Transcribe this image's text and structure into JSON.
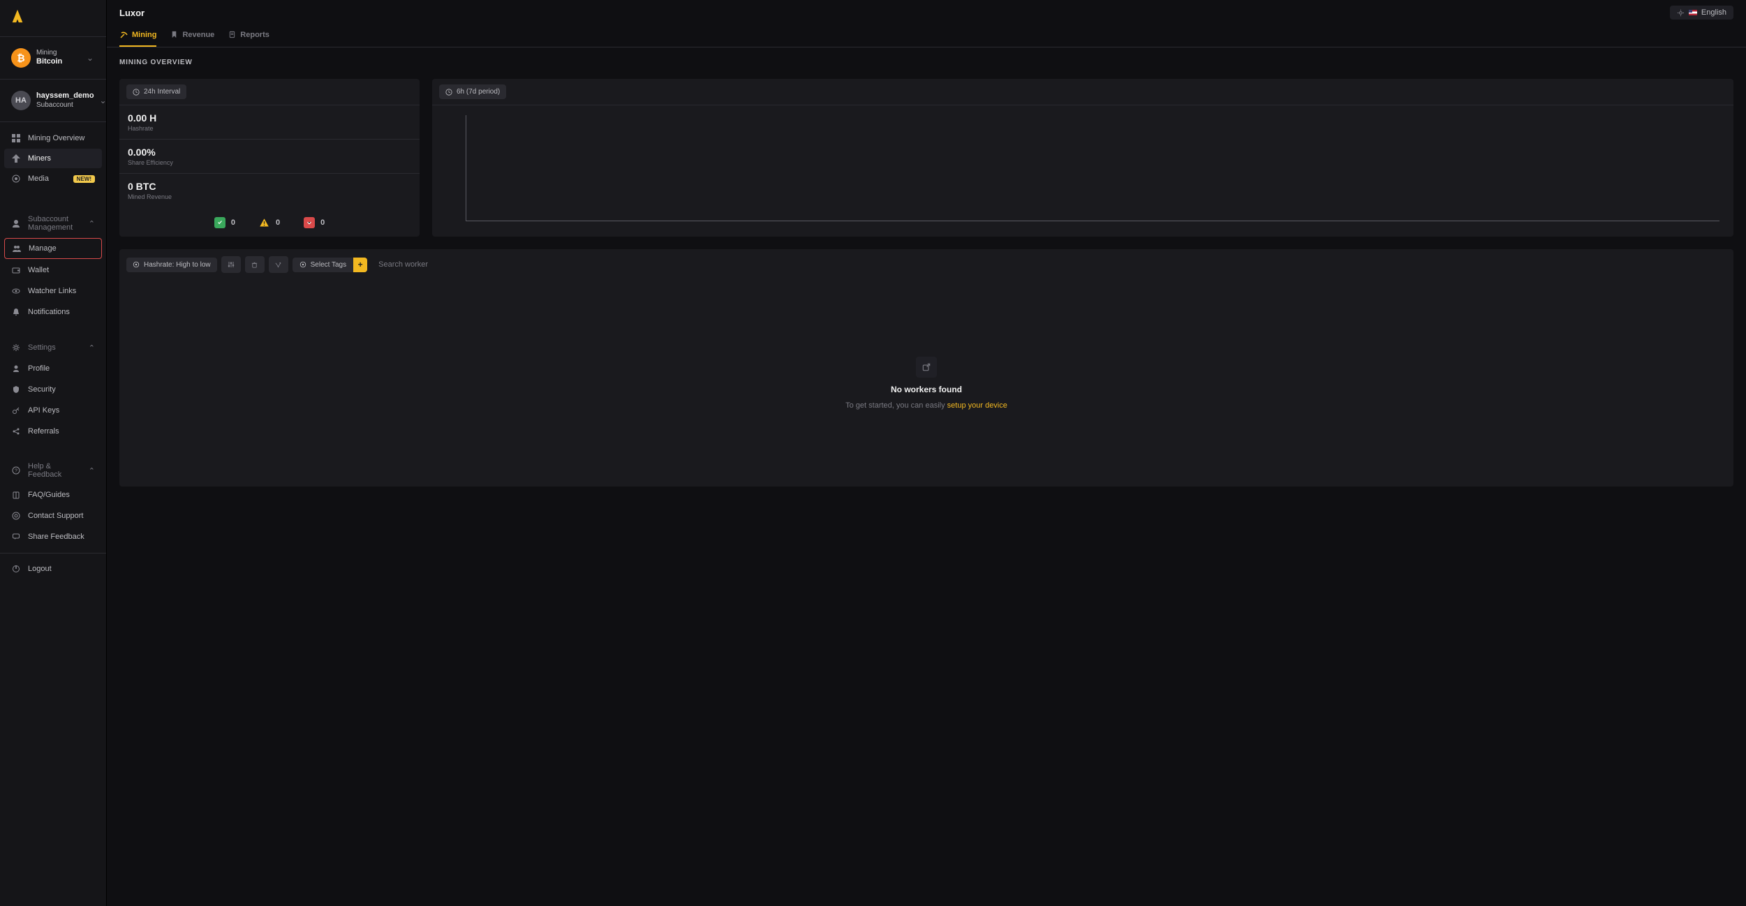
{
  "header": {
    "title": "Luxor",
    "lang_label": "English"
  },
  "sidebar": {
    "mining_picker": {
      "supertitle": "Mining",
      "title": "Bitcoin",
      "icon_letter": "₿"
    },
    "account_picker": {
      "initials": "HA",
      "title": "hayssem_demo",
      "subtitle": "Subaccount"
    },
    "nav": {
      "overview": "Mining Overview",
      "miners": "Miners",
      "media": "Media",
      "media_badge": "New!"
    },
    "sub_mgmt": {
      "head": "Subaccount Management",
      "manage": "Manage",
      "wallet": "Wallet",
      "watcher": "Watcher Links",
      "notifications": "Notifications"
    },
    "settings": {
      "head": "Settings",
      "profile": "Profile",
      "security": "Security",
      "api": "API Keys",
      "referrals": "Referrals"
    },
    "help": {
      "head": "Help & Feedback",
      "faq": "FAQ/Guides",
      "support": "Contact Support",
      "share": "Share Feedback"
    },
    "logout": "Logout"
  },
  "tabs": {
    "mining": "Mining",
    "revenue": "Revenue",
    "reports": "Reports"
  },
  "overview": {
    "title": "Mining Overview",
    "interval_chip": "24h Interval",
    "period_chip": "6h (7d period)",
    "hashrate_val": "0.00 H",
    "hashrate_lbl": "Hashrate",
    "eff_val": "0.00%",
    "eff_lbl": "Share Efficiency",
    "rev_val": "0 BTC",
    "rev_lbl": "Mined Revenue",
    "status": {
      "ok": "0",
      "warn": "0",
      "err": "0"
    }
  },
  "workers": {
    "sort_chip": "Hashrate: High to low",
    "tags_chip": "Select Tags",
    "search_placeholder": "Search worker",
    "empty_title": "No workers found",
    "empty_desc_prefix": "To get started, you can easily ",
    "empty_desc_link": "setup your device"
  },
  "chart_data": {
    "type": "line",
    "title": "",
    "xlabel": "",
    "ylabel": "",
    "x": [],
    "series": [],
    "ylim": [
      0,
      0
    ],
    "note": "empty chart — no data plotted in screenshot"
  }
}
